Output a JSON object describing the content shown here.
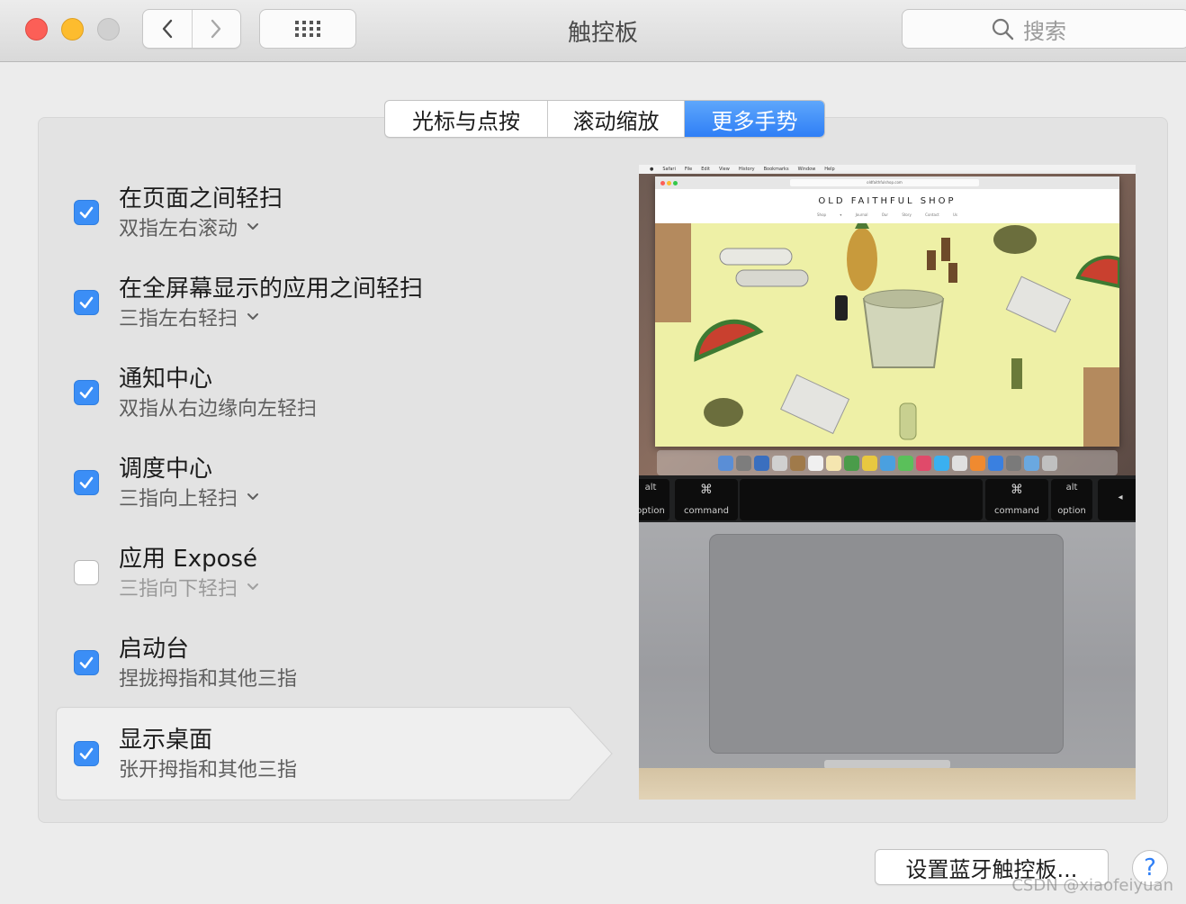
{
  "window": {
    "title": "触控板"
  },
  "toolbar": {
    "search_placeholder": "搜索"
  },
  "tabs": [
    {
      "label": "光标与点按",
      "selected": false
    },
    {
      "label": "滚动缩放",
      "selected": false
    },
    {
      "label": "更多手势",
      "selected": true
    }
  ],
  "gestures": [
    {
      "title": "在页面之间轻扫",
      "subtitle": "双指左右滚动",
      "checked": true,
      "has_menu": true
    },
    {
      "title": "在全屏幕显示的应用之间轻扫",
      "subtitle": "三指左右轻扫",
      "checked": true,
      "has_menu": true
    },
    {
      "title": "通知中心",
      "subtitle": "双指从右边缘向左轻扫",
      "checked": true,
      "has_menu": false
    },
    {
      "title": "调度中心",
      "subtitle": "三指向上轻扫",
      "checked": true,
      "has_menu": true
    },
    {
      "title": "应用 Exposé",
      "subtitle": "三指向下轻扫",
      "checked": false,
      "has_menu": true
    },
    {
      "title": "启动台",
      "subtitle": "捏拢拇指和其他三指",
      "checked": true,
      "has_menu": false
    },
    {
      "title": "显示桌面",
      "subtitle": "张开拇指和其他三指",
      "checked": true,
      "has_menu": false,
      "selected": true
    }
  ],
  "preview": {
    "shop_title": "OLD FAITHFUL SHOP",
    "url": "oldfaithfulshop.com",
    "menu_items": [
      "Safari",
      "File",
      "Edit",
      "View",
      "History",
      "Bookmarks",
      "Window",
      "Help"
    ],
    "shop_nav": "Shop ▾ Journal Our Story Contact Us",
    "keys": {
      "option_left": {
        "top": "alt",
        "bottom": "option"
      },
      "command_left": {
        "top": "⌘",
        "bottom": "command"
      },
      "command_right": {
        "top": "⌘",
        "bottom": "command"
      },
      "option_right": {
        "top": "alt",
        "bottom": "option"
      },
      "arrow": "◂"
    }
  },
  "footer": {
    "bluetooth_button": "设置蓝牙触控板...",
    "help_button": "?",
    "watermark": "CSDN @xiaofeiyuan"
  },
  "colors": {
    "accent": "#3b8ef6",
    "tab_selected": "#2f7ff6",
    "panel": "#e3e3e3"
  }
}
